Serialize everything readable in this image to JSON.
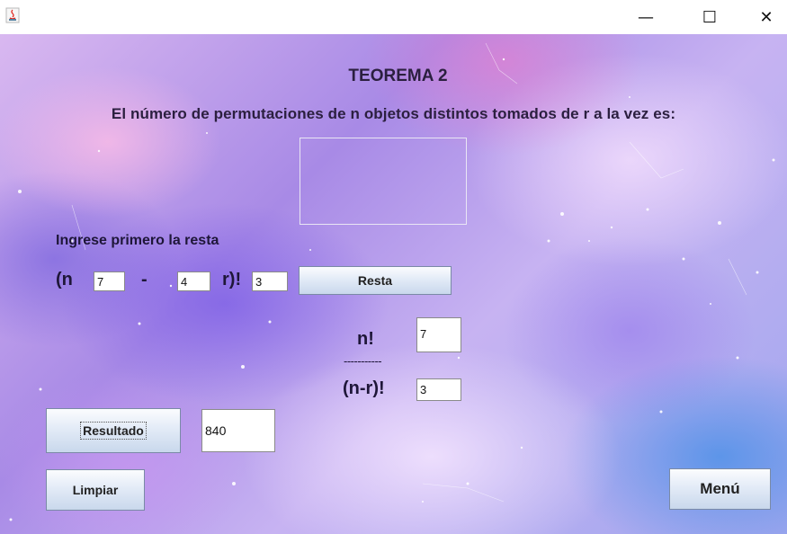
{
  "window": {
    "minimize_glyph": "—",
    "maximize_glyph": "☐",
    "close_glyph": "✕",
    "icon": "java-icon"
  },
  "header": {
    "title": "TEOREMA 2",
    "subtitle": "El número de permutaciones de n objetos distintos tomados de r a la vez es:"
  },
  "subtraction": {
    "instruction": "Ingrese  primero la resta",
    "n_label": "(n",
    "n_value": "7",
    "minus_label": "-",
    "r_value": "4",
    "close_label": "r)!",
    "result_value": "3",
    "button_label": "Resta"
  },
  "fraction": {
    "numerator_label": "n!",
    "numerator_value": "7",
    "divider": "-----------",
    "denominator_label": "(n-r)!",
    "denominator_value": "3"
  },
  "result": {
    "button_label": "Resultado",
    "value": "840"
  },
  "actions": {
    "clear_label": "Limpiar",
    "menu_label": "Menú"
  },
  "colors": {
    "text": "#2b1f3f",
    "button_top": "#fbfcfe",
    "button_bottom": "#c9d8ec"
  }
}
